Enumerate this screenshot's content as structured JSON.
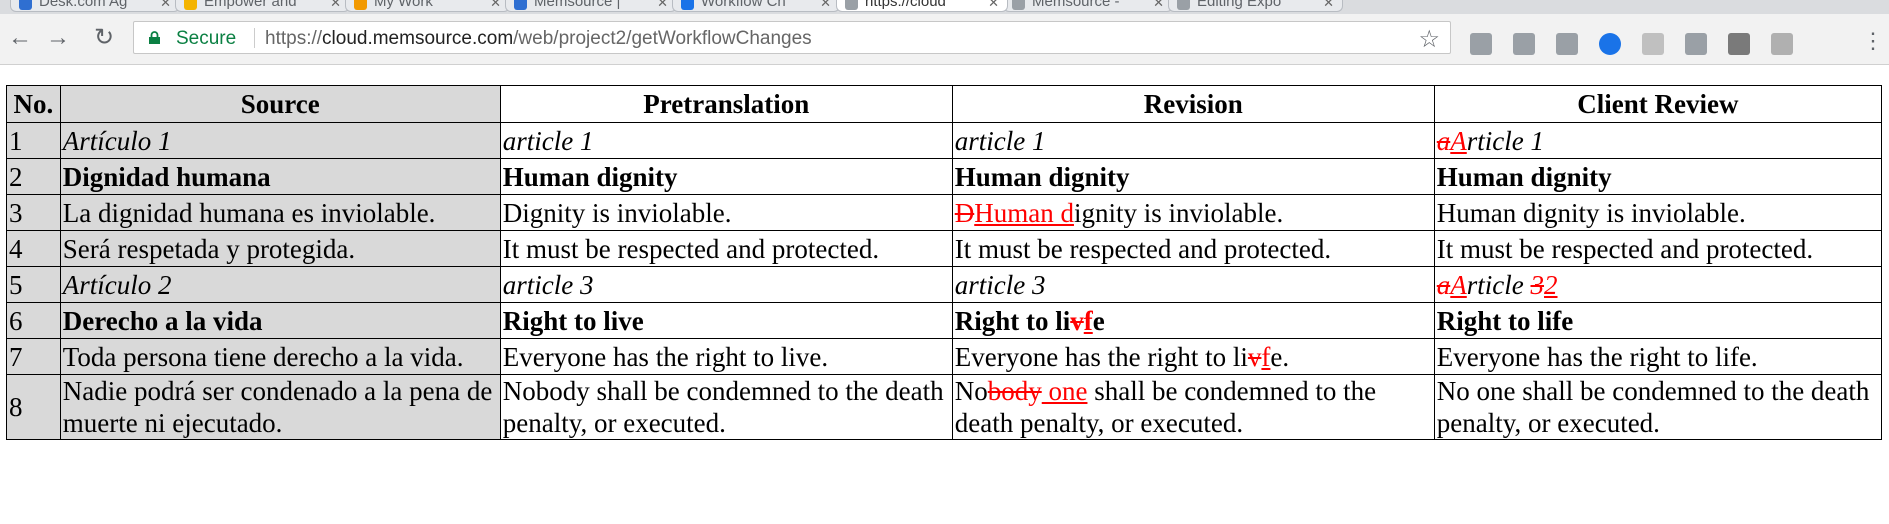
{
  "browser": {
    "tabs": [
      {
        "label": "Desk.com Ag",
        "active": false,
        "favicon_color": "#2f6fd1"
      },
      {
        "label": "Empower and",
        "active": false,
        "favicon_color": "#f4b400"
      },
      {
        "label": "My Work",
        "active": false,
        "favicon_color": "#f29900"
      },
      {
        "label": "Memsource |",
        "active": false,
        "favicon_color": "#2f6fd1"
      },
      {
        "label": "Workflow Ch",
        "active": false,
        "favicon_color": "#1a73e8"
      },
      {
        "label": "https://cloud",
        "active": true,
        "favicon_color": "#9aa0a6"
      },
      {
        "label": "Memsource -",
        "active": false,
        "favicon_color": "#9aa0a6"
      },
      {
        "label": "Editing Expo",
        "active": false,
        "favicon_color": "#9aa0a6"
      }
    ],
    "secure_label": "Secure",
    "url_scheme": "https://",
    "url_host": "cloud.memsource.com",
    "url_path": "/web/project2/getWorkflowChanges",
    "extension_icons": [
      "mail-icon",
      "drive-icon",
      "grammarly-icon",
      "chat-icon",
      "camera-icon",
      "b-icon",
      "square-icon",
      "wsw-icon"
    ]
  },
  "table": {
    "headers": [
      "No.",
      "Source",
      "Pretranslation",
      "Revision",
      "Client Review"
    ],
    "rows": [
      {
        "no": "1",
        "style": "italic",
        "source": "Artículo 1",
        "pretranslation": [
          {
            "t": "article 1"
          }
        ],
        "revision": [
          {
            "t": "article 1"
          }
        ],
        "client_review": [
          {
            "d": "a"
          },
          {
            "i": "A"
          },
          {
            "t": "rticle 1"
          }
        ]
      },
      {
        "no": "2",
        "style": "bold",
        "source": "Dignidad humana",
        "pretranslation": [
          {
            "t": "Human dignity"
          }
        ],
        "revision": [
          {
            "t": "Human dignity"
          }
        ],
        "client_review": [
          {
            "t": "Human dignity"
          }
        ]
      },
      {
        "no": "3",
        "style": "normal",
        "source": "La dignidad humana es inviolable.",
        "pretranslation": [
          {
            "t": "Dignity is inviolable."
          }
        ],
        "revision": [
          {
            "d": "D"
          },
          {
            "i": "Human d"
          },
          {
            "t": "ignity is inviolable."
          }
        ],
        "client_review": [
          {
            "t": "Human dignity is inviolable."
          }
        ]
      },
      {
        "no": "4",
        "style": "normal",
        "source": "Será respetada y protegida.",
        "pretranslation": [
          {
            "t": "It must be respected and protected."
          }
        ],
        "revision": [
          {
            "t": "It must be respected and protected."
          }
        ],
        "client_review": [
          {
            "t": "It must be respected and protected."
          }
        ]
      },
      {
        "no": "5",
        "style": "italic",
        "source": "Artículo 2",
        "pretranslation": [
          {
            "t": "article 3"
          }
        ],
        "revision": [
          {
            "t": "article 3"
          }
        ],
        "client_review": [
          {
            "d": "a"
          },
          {
            "i": "A"
          },
          {
            "t": "rticle "
          },
          {
            "d": "3"
          },
          {
            "i": "2"
          }
        ]
      },
      {
        "no": "6",
        "style": "bold",
        "source": "Derecho a la vida",
        "pretranslation": [
          {
            "t": "Right to live"
          }
        ],
        "revision": [
          {
            "t": "Right to li"
          },
          {
            "d": "v"
          },
          {
            "i": "f"
          },
          {
            "t": "e"
          }
        ],
        "client_review": [
          {
            "t": "Right to life"
          }
        ]
      },
      {
        "no": "7",
        "style": "normal",
        "source": "Toda persona tiene derecho a la vida.",
        "pretranslation": [
          {
            "t": "Everyone has the right to live."
          }
        ],
        "revision": [
          {
            "t": "Everyone has the right to li"
          },
          {
            "d": "v"
          },
          {
            "i": "f"
          },
          {
            "t": "e."
          }
        ],
        "client_review": [
          {
            "t": "Everyone has the right to life."
          }
        ]
      },
      {
        "no": "8",
        "style": "normal",
        "source": "Nadie podrá ser condenado a la pena de muerte ni ejecutado.",
        "pretranslation": [
          {
            "t": "Nobody shall be condemned to the death penalty, or executed."
          }
        ],
        "revision": [
          {
            "t": "No"
          },
          {
            "d": "body"
          },
          {
            "i": " one"
          },
          {
            "t": " shall be condemned to the death penalty, or executed."
          }
        ],
        "client_review": [
          {
            "t": "No one shall be condemned to the death penalty, or executed."
          }
        ]
      }
    ]
  }
}
